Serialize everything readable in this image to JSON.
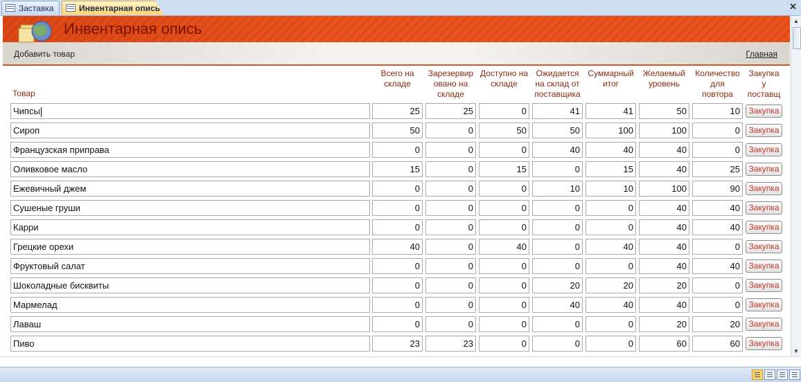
{
  "tabs": [
    {
      "label": "Заставка"
    },
    {
      "label": "Инвентарная опись"
    }
  ],
  "header": {
    "title": "Инвентарная опись"
  },
  "toolbar": {
    "add_label": "Добавить товар",
    "home_label": "Главная"
  },
  "columns": {
    "name": "Товар",
    "total": [
      "Всего на",
      "складе"
    ],
    "reserved": [
      "Зарезервир",
      "овано на",
      "складе"
    ],
    "available": [
      "Доступно на",
      "складе"
    ],
    "expected": [
      "Ожидается",
      "на склад от",
      "поставщика"
    ],
    "sum_total": [
      "Суммарный",
      "итог"
    ],
    "desired": [
      "Желаемый",
      "уровень"
    ],
    "reorder": [
      "Количество",
      "для",
      "повтора"
    ],
    "purchase": [
      "Закупка",
      "у",
      "поставщ"
    ]
  },
  "rows": [
    {
      "name": "Чипсы",
      "total": "25",
      "reserved": "25",
      "available": "0",
      "expected": "41",
      "sum": "41",
      "desired": "50",
      "reorder": "10",
      "button": "Закупка"
    },
    {
      "name": "Сироп",
      "total": "50",
      "reserved": "0",
      "available": "50",
      "expected": "50",
      "sum": "100",
      "desired": "100",
      "reorder": "0",
      "button": "Закупка"
    },
    {
      "name": "Французская приправа",
      "total": "0",
      "reserved": "0",
      "available": "0",
      "expected": "40",
      "sum": "40",
      "desired": "40",
      "reorder": "0",
      "button": "Закупка"
    },
    {
      "name": "Оливковое масло",
      "total": "15",
      "reserved": "0",
      "available": "15",
      "expected": "0",
      "sum": "15",
      "desired": "40",
      "reorder": "25",
      "button": "Закупка"
    },
    {
      "name": "Ежевичный джем",
      "total": "0",
      "reserved": "0",
      "available": "0",
      "expected": "10",
      "sum": "10",
      "desired": "100",
      "reorder": "90",
      "button": "Закупка"
    },
    {
      "name": "Сушеные груши",
      "total": "0",
      "reserved": "0",
      "available": "0",
      "expected": "0",
      "sum": "0",
      "desired": "40",
      "reorder": "40",
      "button": "Закупка"
    },
    {
      "name": "Карри",
      "total": "0",
      "reserved": "0",
      "available": "0",
      "expected": "0",
      "sum": "0",
      "desired": "40",
      "reorder": "40",
      "button": "Закупка"
    },
    {
      "name": "Грецкие орехи",
      "total": "40",
      "reserved": "0",
      "available": "40",
      "expected": "0",
      "sum": "40",
      "desired": "40",
      "reorder": "0",
      "button": "Закупка"
    },
    {
      "name": "Фруктовый салат",
      "total": "0",
      "reserved": "0",
      "available": "0",
      "expected": "0",
      "sum": "0",
      "desired": "40",
      "reorder": "40",
      "button": "Закупка"
    },
    {
      "name": "Шоколадные бисквиты",
      "total": "0",
      "reserved": "0",
      "available": "0",
      "expected": "20",
      "sum": "20",
      "desired": "20",
      "reorder": "0",
      "button": "Закупка"
    },
    {
      "name": "Мармелад",
      "total": "0",
      "reserved": "0",
      "available": "0",
      "expected": "40",
      "sum": "40",
      "desired": "40",
      "reorder": "0",
      "button": "Закупка"
    },
    {
      "name": "Лаваш",
      "total": "0",
      "reserved": "0",
      "available": "0",
      "expected": "0",
      "sum": "0",
      "desired": "20",
      "reorder": "20",
      "button": "Закупка"
    },
    {
      "name": "Пиво",
      "total": "23",
      "reserved": "23",
      "available": "0",
      "expected": "0",
      "sum": "0",
      "desired": "60",
      "reorder": "60",
      "button": "Закупка"
    }
  ],
  "icons": {
    "tab_form": "form-icon",
    "logo": "inventory-boxes-globe-icon",
    "close": "close-icon",
    "views": [
      "form-view-icon",
      "datasheet-view-icon",
      "layout-view-icon",
      "design-view-icon"
    ]
  },
  "colors": {
    "banner": "#e8531e",
    "title": "#7a1200",
    "header_text": "#8a2a10",
    "button_text": "#c0392b",
    "active_tab": "#ffd56a"
  }
}
